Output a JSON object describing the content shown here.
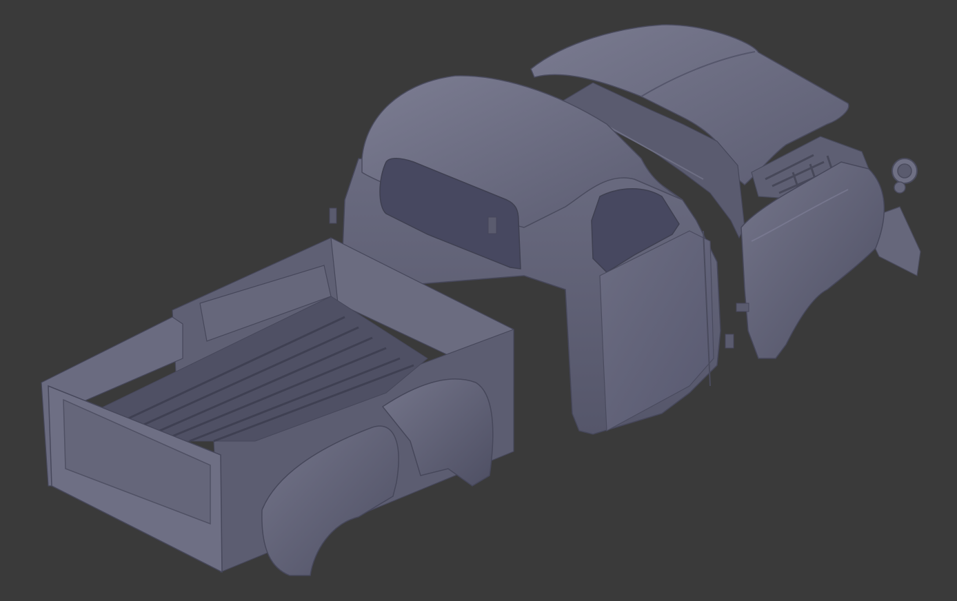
{
  "viewport": {
    "background_color": "#3a3a3a",
    "model_color": "#5f6075",
    "model_highlight": "#7a7b90",
    "model_shadow": "#45465a",
    "model_name": "",
    "parts": [
      "cab",
      "cab-roof",
      "windshield-opening",
      "rear-window-opening",
      "hood",
      "hood-hinge-frame",
      "front-fender-right",
      "grille-assembly",
      "headlight",
      "bumper",
      "pickup-bed",
      "bed-floor-boards",
      "tailgate",
      "rear-fender-right",
      "rear-fender-left",
      "cab-mounting-brackets"
    ]
  }
}
